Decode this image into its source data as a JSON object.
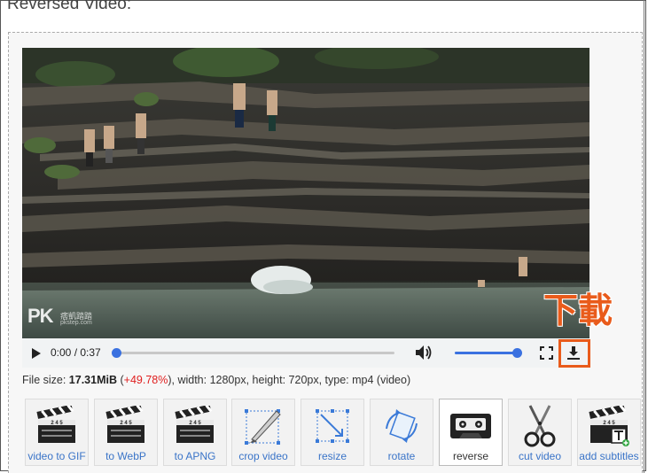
{
  "page": {
    "heading": "Reversed Video:"
  },
  "video": {
    "watermark_main": "PK",
    "watermark_sub": "痞凱踏踏",
    "watermark_sub2": "pkstep.com",
    "time_display": "0:00 / 0:37",
    "progress": 0,
    "volume": 1.0,
    "icons": {
      "play": "play-icon",
      "volume": "volume-icon",
      "fullscreen": "fullscreen-icon",
      "download": "download-icon"
    }
  },
  "callout": {
    "text": "下載",
    "color": "#e95b1b"
  },
  "file_info": {
    "prefix": "File size: ",
    "size": "17.31MiB",
    "open": " (",
    "percent": "+49.78%",
    "close": "), width: 1280px, height: 720px, type: mp4 (video)"
  },
  "tools": [
    {
      "label": "video to GIF",
      "icon": "clapperboard-icon"
    },
    {
      "label": "to WebP",
      "icon": "clapperboard-icon"
    },
    {
      "label": "to APNG",
      "icon": "clapperboard-icon"
    },
    {
      "label": "crop video",
      "icon": "crop-icon"
    },
    {
      "label": "resize",
      "icon": "resize-icon"
    },
    {
      "label": "rotate",
      "icon": "rotate-icon"
    },
    {
      "label": "reverse",
      "icon": "cassette-icon"
    },
    {
      "label": "cut video",
      "icon": "scissors-icon"
    },
    {
      "label": "add subtitles",
      "icon": "subtitle-icon"
    }
  ],
  "clapper_digits": "2 4 5",
  "colors": {
    "accent": "#3a71e0",
    "link": "#3a74c8",
    "highlight": "#e95b1b",
    "percent": "#e02020"
  }
}
